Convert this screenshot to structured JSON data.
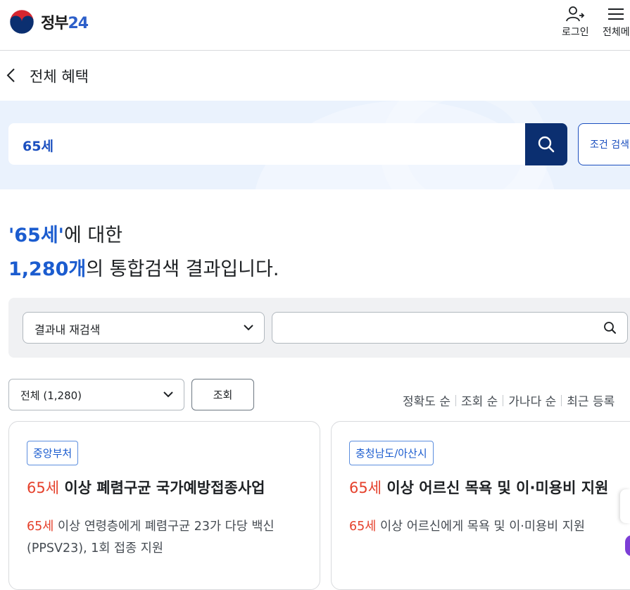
{
  "header": {
    "logo_text_main": "정부",
    "logo_text_num": "24",
    "login_label": "로그인",
    "allmenu_label": "전체메"
  },
  "page": {
    "title": "전체 혜택"
  },
  "search": {
    "query": "65세",
    "condition_button": "조건 검색"
  },
  "result": {
    "keyword": "'65세'",
    "keyword_suffix": "에 대한",
    "count": "1,280개",
    "count_suffix": "의 통합검색 결과입니다."
  },
  "filter": {
    "select_value": "결과내 재검색",
    "input_value": ""
  },
  "list_controls": {
    "type_select": "전체 (1,280)",
    "view_button": "조회",
    "sorts": [
      "정확도 순",
      "조회 순",
      "가나다 순",
      "최근 등록"
    ]
  },
  "cards": [
    {
      "badge": "중앙부처",
      "title_hl": "65세",
      "title_rest": " 이상 폐렴구균 국가예방접종사업",
      "desc_hl": "65세",
      "desc_rest": " 이상 연령층에게 폐렴구균 23가 다당 백신(PPSV23), 1회 접종 지원"
    },
    {
      "badge": "충청남도/아산시",
      "title_hl": "65세",
      "title_rest": " 이상 어르신 목욕 및 이·미용비 지원",
      "desc_hl": "65세",
      "desc_rest": " 이상 어르신에게 목욕 및 이·미용비 지원"
    }
  ],
  "colors": {
    "brand_navy": "#0b2f70",
    "accent_blue": "#1b5ccf",
    "highlight_red": "#e5412c",
    "band_bg": "#eaf2fd"
  }
}
